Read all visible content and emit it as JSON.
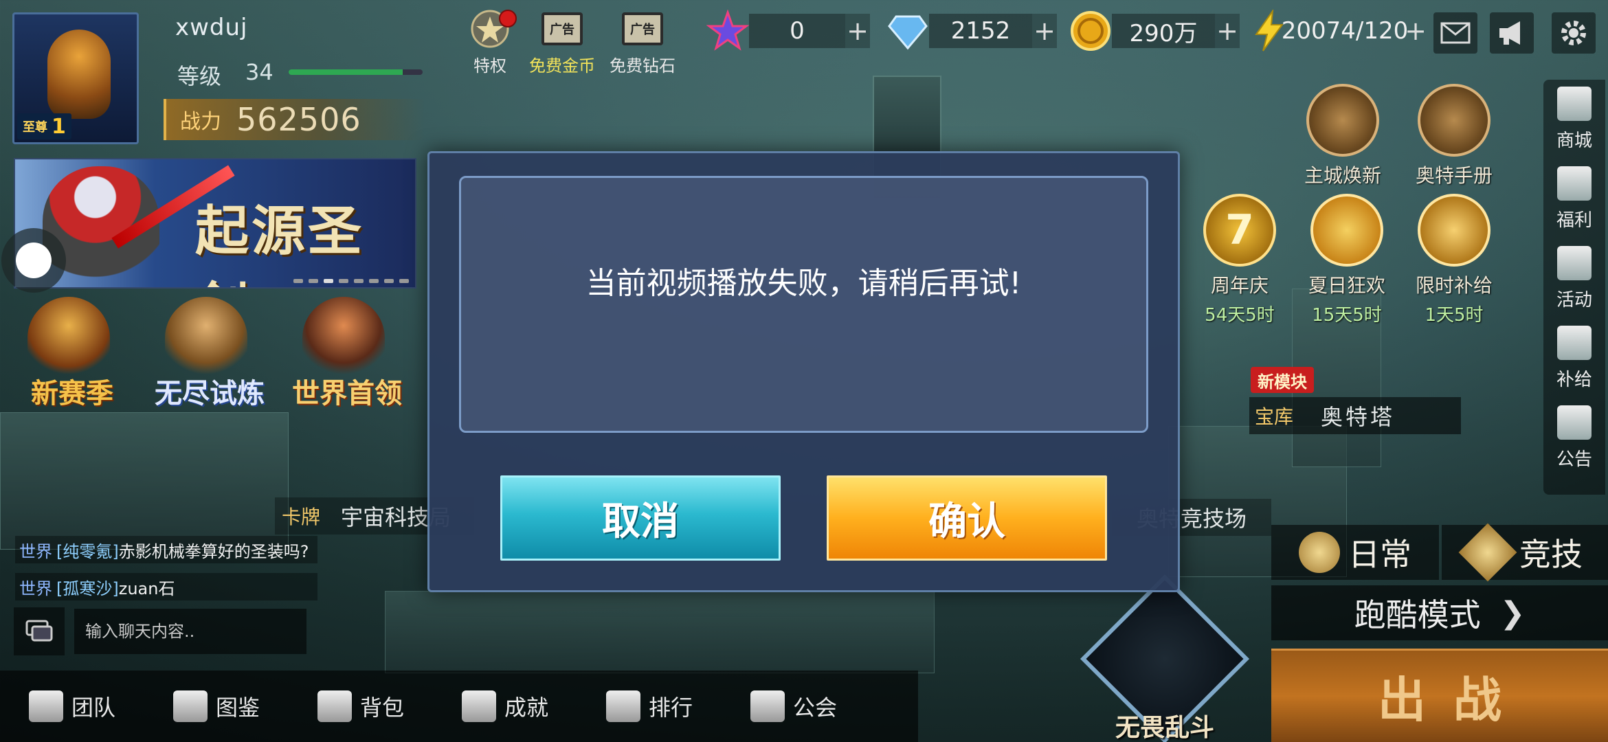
{
  "player": {
    "name": "xwduj",
    "level_label": "等级",
    "level": "34",
    "level_progress": 0.85,
    "rank_label": "至尊",
    "rank_level": "1",
    "power_label": "战力",
    "power": "562506"
  },
  "top_icons": [
    {
      "label": "特权",
      "icon": "star-badge-icon"
    },
    {
      "label": "免费金币",
      "icon": "ad-film-icon",
      "ad_text": "广告"
    },
    {
      "label": "免费钻石",
      "icon": "ad-film-icon",
      "ad_text": "广告"
    }
  ],
  "currencies": [
    {
      "icon": "star-gem-icon",
      "value": "0"
    },
    {
      "icon": "diamond-icon",
      "value": "2152"
    },
    {
      "icon": "gold-coin-icon",
      "value": "290万"
    },
    {
      "icon": "lightning-icon",
      "value": "20074/120"
    }
  ],
  "plus_symbol": "+",
  "banner": {
    "title": "起源圣剑"
  },
  "events_left": [
    {
      "label": "新赛季",
      "color": "#e8a030"
    },
    {
      "label": "无尽试炼",
      "color": "#3a6fd6"
    },
    {
      "label": "世界首领",
      "color": "#d8722a"
    }
  ],
  "right_top_icons": [
    {
      "label": "主城焕新",
      "icon": "city-icon"
    },
    {
      "label": "奥特手册",
      "icon": "handbook-icon"
    }
  ],
  "right_events": [
    {
      "label": "周年庆",
      "time": "54天5时",
      "icon": "anniversary-7-icon"
    },
    {
      "label": "夏日狂欢",
      "time": "15天5时",
      "icon": "watermelon-icon"
    },
    {
      "label": "限时补给",
      "time": "1天5时",
      "icon": "supply-box-icon"
    }
  ],
  "side_menu": [
    {
      "label": "商城",
      "icon": "cart-icon"
    },
    {
      "label": "福利",
      "icon": "gift-icon"
    },
    {
      "label": "活动",
      "icon": "activity-icon"
    },
    {
      "label": "补给",
      "icon": "supply-icon"
    },
    {
      "label": "公告",
      "icon": "notice-icon"
    }
  ],
  "map_tags": {
    "new_module": "新模块",
    "treasury": "宝库",
    "tower": "奥特塔",
    "card": "卡牌",
    "tech": "宇宙科技局",
    "arena": "奥特竞技场"
  },
  "dialog": {
    "message": "当前视频播放失败，请稍后再试!",
    "cancel": "取消",
    "confirm": "确认"
  },
  "chat": {
    "messages": [
      {
        "channel": "世界",
        "name": "[纯零氪]",
        "text": "赤影机械拳算好的圣装吗?"
      },
      {
        "channel": "世界",
        "name": "[孤寒沙]",
        "text": "zuan石"
      }
    ],
    "placeholder": "输入聊天内容.."
  },
  "bottom_nav": [
    {
      "label": "团队",
      "icon": "team-icon"
    },
    {
      "label": "图鉴",
      "icon": "codex-icon"
    },
    {
      "label": "背包",
      "icon": "bag-icon"
    },
    {
      "label": "成就",
      "icon": "trophy-icon"
    },
    {
      "label": "排行",
      "icon": "ranking-icon"
    },
    {
      "label": "公会",
      "icon": "guild-icon"
    }
  ],
  "modes": {
    "daily": "日常",
    "compete": "竞技",
    "parkour": "跑酷模式",
    "brawl": "无畏乱斗",
    "fight": "出战"
  }
}
